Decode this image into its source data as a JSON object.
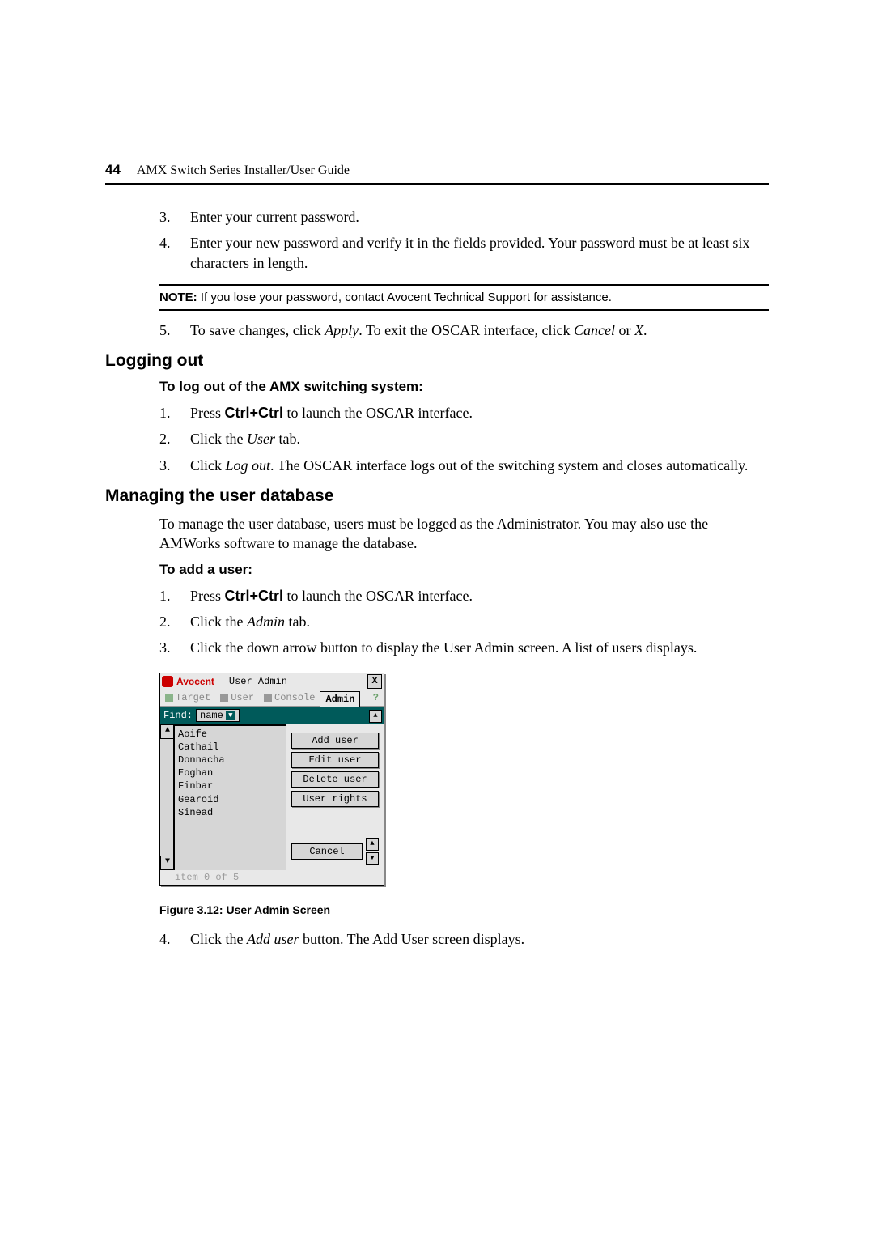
{
  "header": {
    "page_number": "44",
    "guide_title": "AMX Switch Series Installer/User Guide"
  },
  "steps_a": [
    {
      "n": "3.",
      "text": "Enter your current password."
    },
    {
      "n": "4.",
      "text_parts": [
        "Enter your new password and verify it in the fields provided. Your password must be at least six characters in length."
      ]
    }
  ],
  "note": {
    "label": "NOTE:",
    "text": " If you lose your password, contact Avocent Technical Support for assistance."
  },
  "steps_b": [
    {
      "n": "5.",
      "prefix": "To save changes, click ",
      "em1": "Apply",
      "mid": ". To exit the OSCAR interface, click ",
      "em2": "Cancel",
      "mid2": " or ",
      "em3": "X",
      "suffix": "."
    }
  ],
  "h_logout": "Logging out",
  "h_logout_sub": "To log out of the AMX switching system:",
  "steps_logout": [
    {
      "n": "1.",
      "prefix": "Press ",
      "strong": "Ctrl+Ctrl",
      "suffix": " to launch the OSCAR interface."
    },
    {
      "n": "2.",
      "prefix": "Click the ",
      "em": "User",
      "suffix": " tab."
    },
    {
      "n": "3.",
      "prefix": "Click ",
      "em": "Log out",
      "suffix": ". The OSCAR interface logs out of the switching system and closes automatically."
    }
  ],
  "h_manage": "Managing the user database",
  "p_manage": "To manage the user database, users must be logged as the Administrator. You may also use the AMWorks software to manage the database.",
  "h_add": "To add a user:",
  "steps_add": [
    {
      "n": "1.",
      "prefix": "Press ",
      "strong": "Ctrl+Ctrl",
      "suffix": " to launch the OSCAR interface."
    },
    {
      "n": "2.",
      "prefix": "Click the ",
      "em": "Admin",
      "suffix": " tab."
    },
    {
      "n": "3.",
      "text": "Click the down arrow button to display the User Admin screen. A list of users displays."
    }
  ],
  "dialog": {
    "logo": "Avocent",
    "title": "User Admin",
    "close": "X",
    "tabs": {
      "target": "Target",
      "user": "User",
      "console": "Console",
      "admin": "Admin",
      "help": "?"
    },
    "find_label": "Find:",
    "find_value": "name",
    "users": [
      "Aoife",
      "Cathail",
      "Donnacha",
      "Eoghan",
      "Finbar",
      "Gearoid",
      "Sinead"
    ],
    "buttons": {
      "add": "Add user",
      "edit": "Edit user",
      "del": "Delete user",
      "rights": "User rights",
      "cancel": "Cancel"
    },
    "status": "item 0 of 5"
  },
  "fig_caption": "Figure 3.12: User Admin Screen",
  "steps_after": [
    {
      "n": "4.",
      "prefix": "Click the ",
      "em": "Add user",
      "suffix": " button. The Add User screen displays."
    }
  ]
}
